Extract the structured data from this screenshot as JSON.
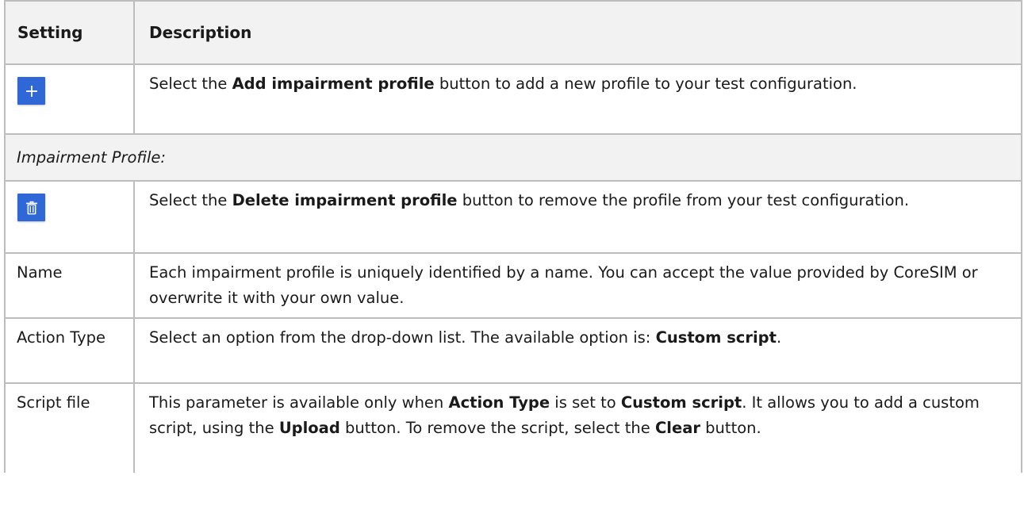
{
  "table": {
    "headers": {
      "setting": "Setting",
      "description": "Description"
    },
    "rows": {
      "add": {
        "icon": "plus-icon",
        "desc_pre": "Select the ",
        "desc_bold": "Add impairment profile",
        "desc_post": " button to add a new profile to your test configuration."
      },
      "section": {
        "label": "Impairment Profile:"
      },
      "delete": {
        "icon": "trash-icon",
        "desc_pre": "Select the ",
        "desc_bold": "Delete impairment profile",
        "desc_post": " button to remove the profile from your test configuration."
      },
      "name": {
        "setting": "Name",
        "desc": "Each impairment profile is uniquely identified by a name. You can accept the value provided by CoreSIM or overwrite it with your own value."
      },
      "action_type": {
        "setting": "Action Type",
        "desc_pre": "Select an option from the drop-down list. The available option is: ",
        "desc_bold": "Custom script",
        "desc_post": "."
      },
      "script_file": {
        "setting": "Script file",
        "desc_1": "This parameter is available only when ",
        "desc_b1": "Action Type",
        "desc_2": " is set to ",
        "desc_b2": "Custom script",
        "desc_3": ". It allows you to add a custom script, using the ",
        "desc_b3": "Upload",
        "desc_4": " button. To remove the script, select the ",
        "desc_b4": "Clear",
        "desc_5": " button."
      }
    }
  },
  "colors": {
    "icon_button_bg": "#2f67d6",
    "header_bg": "#f2f2f2",
    "border": "#bdbdbd"
  }
}
